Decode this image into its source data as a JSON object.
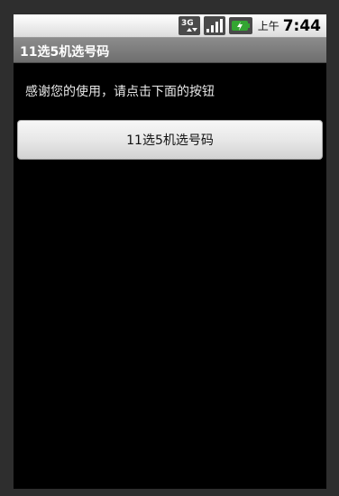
{
  "status_bar": {
    "network_label": "3G",
    "ampm": "上午",
    "time": "7:44",
    "battery_color": "#33a532"
  },
  "app": {
    "title": "11选5机选号码",
    "message": "感谢您的使用，请点击下面的按钮",
    "button_label": "11选5机选号码"
  }
}
